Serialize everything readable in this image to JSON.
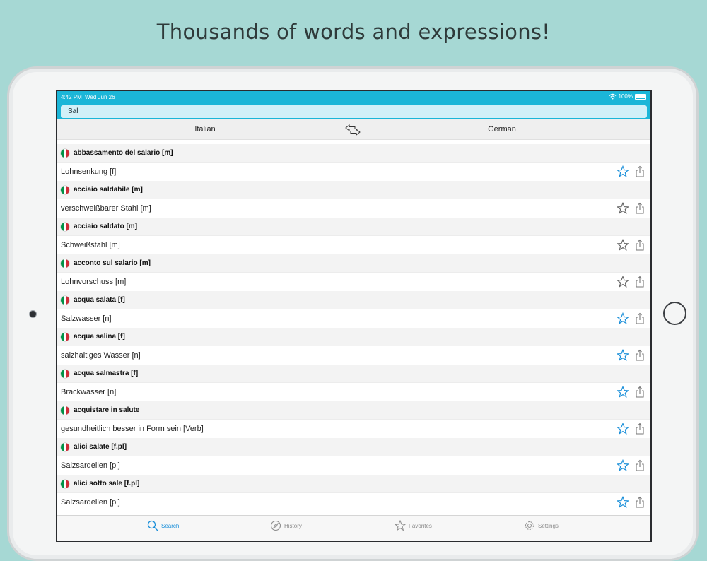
{
  "headline": "Thousands of words and expressions!",
  "status": {
    "time": "4:42 PM",
    "date": "Wed Jun 26",
    "battery": "100%"
  },
  "search": {
    "value": "Sal"
  },
  "languages": {
    "left": "Italian",
    "right": "German"
  },
  "entries": [
    {
      "source": "abbassamento del salario [m]",
      "target": "Lohnsenkung [f]",
      "favorite": true
    },
    {
      "source": "acciaio saldabile [m]",
      "target": "verschweißbarer Stahl [m]",
      "favorite": false
    },
    {
      "source": "acciaio saldato [m]",
      "target": "Schweißstahl [m]",
      "favorite": false
    },
    {
      "source": "acconto sul salario [m]",
      "target": "Lohnvorschuss [m]",
      "favorite": false
    },
    {
      "source": "acqua salata [f]",
      "target": "Salzwasser [n]",
      "favorite": true
    },
    {
      "source": "acqua salina [f]",
      "target": "salzhaltiges Wasser [n]",
      "favorite": true
    },
    {
      "source": "acqua salmastra [f]",
      "target": "Brackwasser [n]",
      "favorite": true
    },
    {
      "source": "acquistare in salute",
      "target": "gesundheitlich besser in Form sein [Verb]",
      "favorite": true
    },
    {
      "source": "alici salate [f.pl]",
      "target": "Salzsardellen [pl]",
      "favorite": true
    },
    {
      "source": "alici sotto sale [f.pl]",
      "target": "Salzsardellen [pl]",
      "favorite": true
    }
  ],
  "tabs": [
    {
      "label": "Search",
      "icon": "search-icon",
      "active": true
    },
    {
      "label": "History",
      "icon": "compass-icon",
      "active": false
    },
    {
      "label": "Favorites",
      "icon": "star-icon",
      "active": false
    },
    {
      "label": "Settings",
      "icon": "gear-icon",
      "active": false
    }
  ],
  "colors": {
    "background": "#a6d8d4",
    "accent": "#1bb6d8",
    "favorite_active": "#1a8fd9",
    "favorite_inactive": "#666666"
  }
}
